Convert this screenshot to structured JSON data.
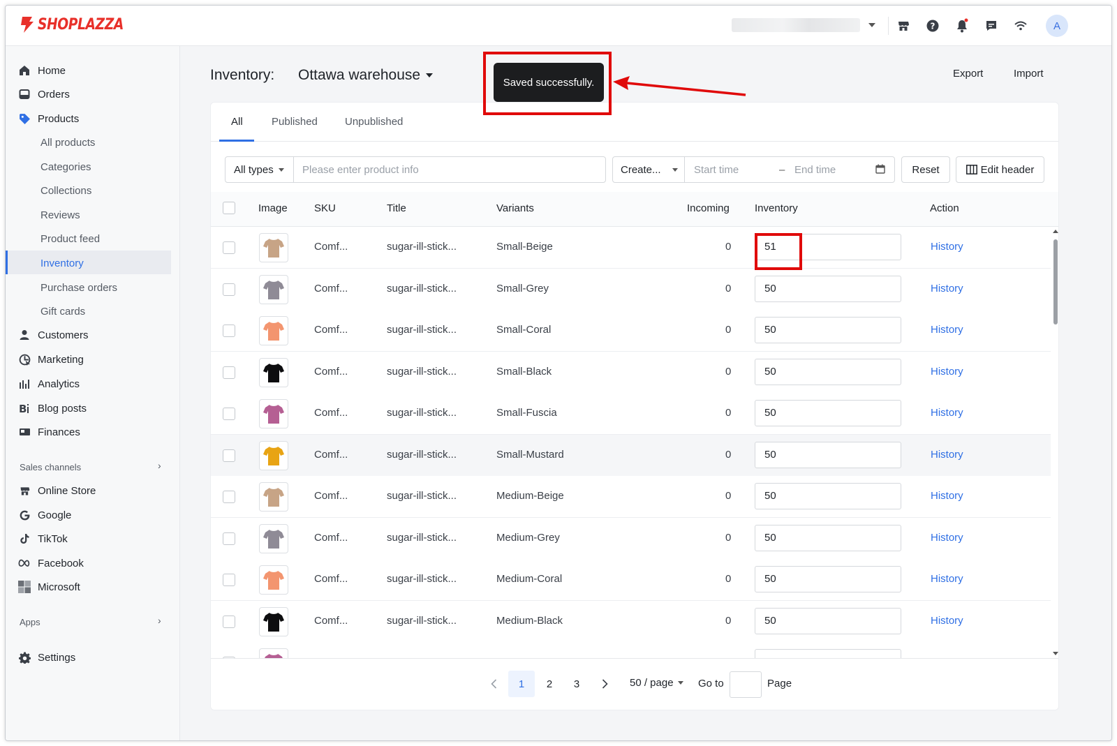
{
  "app": {
    "brand": "SHOPLAZZA",
    "avatar_initial": "A",
    "brand_color": "#e8302a",
    "accent_color": "#2f6fe4"
  },
  "top_icons": [
    "store-icon",
    "help-icon",
    "bell-icon",
    "chat-icon",
    "wifi-icon"
  ],
  "sidebar": {
    "items": [
      {
        "label": "Home",
        "icon": "home-icon"
      },
      {
        "label": "Orders",
        "icon": "orders-icon"
      },
      {
        "label": "Products",
        "icon": "products-tag-icon"
      },
      {
        "label": "Customers",
        "icon": "customers-icon"
      },
      {
        "label": "Marketing",
        "icon": "marketing-icon"
      },
      {
        "label": "Analytics",
        "icon": "analytics-icon"
      },
      {
        "label": "Blog posts",
        "icon": "blog-icon"
      },
      {
        "label": "Finances",
        "icon": "finances-icon"
      }
    ],
    "product_subitems": [
      "All products",
      "Categories",
      "Collections",
      "Reviews",
      "Product feed",
      "Inventory",
      "Purchase orders",
      "Gift cards"
    ],
    "active_subitem": "Inventory",
    "sales_channels_label": "Sales channels",
    "channels": [
      {
        "label": "Online Store",
        "icon": "store-icon"
      },
      {
        "label": "Google",
        "icon": "google-icon"
      },
      {
        "label": "TikTok",
        "icon": "tiktok-icon"
      },
      {
        "label": "Facebook",
        "icon": "meta-icon"
      },
      {
        "label": "Microsoft",
        "icon": "microsoft-icon"
      }
    ],
    "apps_label": "Apps",
    "settings_label": "Settings"
  },
  "header": {
    "title": "Inventory:",
    "warehouse": "Ottawa warehouse",
    "export_label": "Export",
    "import_label": "Import"
  },
  "toast": {
    "message": "Saved successfully."
  },
  "tabs": [
    "All",
    "Published",
    "Unpublished"
  ],
  "filters": {
    "type_select": "All types",
    "search_placeholder": "Please enter product info",
    "date_field_select": "Create...",
    "start_placeholder": "Start time",
    "range_sep": "–",
    "end_placeholder": "End time",
    "reset_label": "Reset",
    "edit_header_label": "Edit header"
  },
  "table": {
    "columns": [
      "Image",
      "SKU",
      "Title",
      "Variants",
      "Incoming",
      "Inventory",
      "Action"
    ],
    "rows": [
      {
        "sku": "Comf...",
        "title": "sugar-ill-stick...",
        "variant": "Small-Beige",
        "incoming": "0",
        "inventory": "51",
        "action": "History",
        "color": "#c7a486"
      },
      {
        "sku": "Comf...",
        "title": "sugar-ill-stick...",
        "variant": "Small-Grey",
        "incoming": "0",
        "inventory": "50",
        "action": "History",
        "color": "#8f8b96"
      },
      {
        "sku": "Comf...",
        "title": "sugar-ill-stick...",
        "variant": "Small-Coral",
        "incoming": "0",
        "inventory": "50",
        "action": "History",
        "color": "#f3956f"
      },
      {
        "sku": "Comf...",
        "title": "sugar-ill-stick...",
        "variant": "Small-Black",
        "incoming": "0",
        "inventory": "50",
        "action": "History",
        "color": "#0d0d0f"
      },
      {
        "sku": "Comf...",
        "title": "sugar-ill-stick...",
        "variant": "Small-Fuscia",
        "incoming": "0",
        "inventory": "50",
        "action": "History",
        "color": "#b55f93"
      },
      {
        "sku": "Comf...",
        "title": "sugar-ill-stick...",
        "variant": "Small-Mustard",
        "incoming": "0",
        "inventory": "50",
        "action": "History",
        "color": "#e8a414"
      },
      {
        "sku": "Comf...",
        "title": "sugar-ill-stick...",
        "variant": "Medium-Beige",
        "incoming": "0",
        "inventory": "50",
        "action": "History",
        "color": "#c7a486"
      },
      {
        "sku": "Comf...",
        "title": "sugar-ill-stick...",
        "variant": "Medium-Grey",
        "incoming": "0",
        "inventory": "50",
        "action": "History",
        "color": "#8f8b96"
      },
      {
        "sku": "Comf...",
        "title": "sugar-ill-stick...",
        "variant": "Medium-Coral",
        "incoming": "0",
        "inventory": "50",
        "action": "History",
        "color": "#f3956f"
      },
      {
        "sku": "Comf...",
        "title": "sugar-ill-stick...",
        "variant": "Medium-Black",
        "incoming": "0",
        "inventory": "50",
        "action": "History",
        "color": "#0d0d0f"
      },
      {
        "sku": "",
        "title": "",
        "variant": "",
        "incoming": "",
        "inventory": "",
        "action": "",
        "color": "#b55f93"
      }
    ]
  },
  "pagination": {
    "pages": [
      "1",
      "2",
      "3"
    ],
    "current": "1",
    "page_size": "50 / page",
    "goto_label": "Go to",
    "page_label": "Page"
  }
}
